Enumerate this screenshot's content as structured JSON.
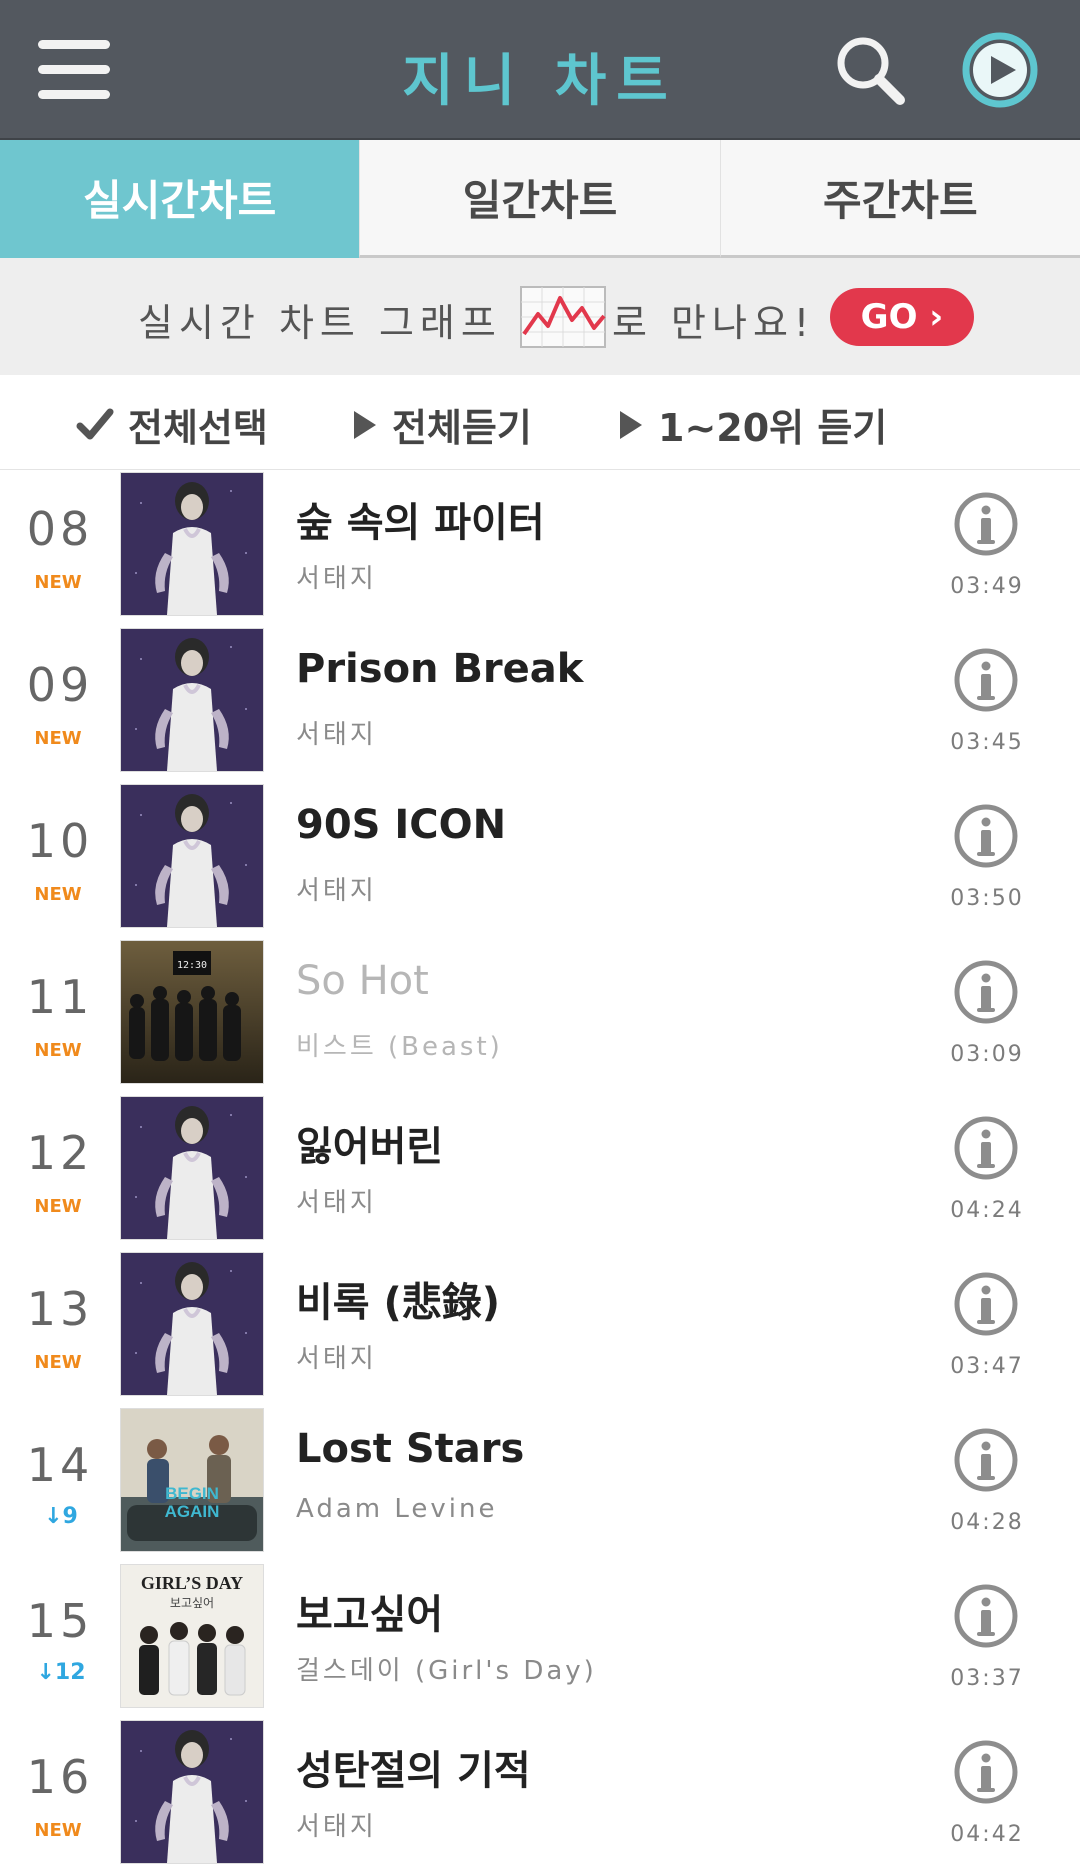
{
  "header": {
    "title": "지니 차트",
    "menu_icon": "hamburger-menu-icon",
    "search_icon": "search-icon",
    "play_icon": "play-circle-icon",
    "accent_color": "#5ec6cf"
  },
  "tabs": [
    {
      "label": "실시간차트",
      "active": true
    },
    {
      "label": "일간차트",
      "active": false
    },
    {
      "label": "주간차트",
      "active": false
    }
  ],
  "banner": {
    "text_before": "실시간 차트 그래프",
    "text_after": "로 만나요!",
    "graph_icon": "line-graph-icon",
    "go_label": "GO ›"
  },
  "actions": {
    "select_all": "전체선택",
    "play_all": "전체듣기",
    "play_top20": "1~20위 듣기"
  },
  "songs": [
    {
      "rank": "08",
      "change": "NEW",
      "title": "숲 속의 파이터",
      "artist": "서태지",
      "duration": "03:49",
      "art": "seotaiji-girl-cover",
      "dim": false
    },
    {
      "rank": "09",
      "change": "NEW",
      "title": "Prison Break",
      "artist": "서태지",
      "duration": "03:45",
      "art": "seotaiji-girl-cover",
      "dim": false
    },
    {
      "rank": "10",
      "change": "NEW",
      "title": "90S ICON",
      "artist": "서태지",
      "duration": "03:50",
      "art": "seotaiji-girl-cover",
      "dim": false
    },
    {
      "rank": "11",
      "change": "NEW",
      "title": "So Hot",
      "artist": "비스트 (Beast)",
      "duration": "03:09",
      "art": "beast-group-cover",
      "dim": true
    },
    {
      "rank": "12",
      "change": "NEW",
      "title": "잃어버린",
      "artist": "서태지",
      "duration": "04:24",
      "art": "seotaiji-girl-cover",
      "dim": false
    },
    {
      "rank": "13",
      "change": "NEW",
      "title": "비록 (悲錄)",
      "artist": "서태지",
      "duration": "03:47",
      "art": "seotaiji-girl-cover",
      "dim": false
    },
    {
      "rank": "14",
      "change": "↓9",
      "title": "Lost Stars",
      "artist": "Adam Levine",
      "duration": "04:28",
      "art": "begin-again-cover",
      "dim": false
    },
    {
      "rank": "15",
      "change": "↓12",
      "title": "보고싶어",
      "artist": "걸스데이 (Girl's Day)",
      "duration": "03:37",
      "art": "girlsday-cover",
      "dim": false
    },
    {
      "rank": "16",
      "change": "NEW",
      "title": "성탄절의 기적",
      "artist": "서태지",
      "duration": "04:42",
      "art": "seotaiji-girl-cover",
      "dim": false
    }
  ]
}
